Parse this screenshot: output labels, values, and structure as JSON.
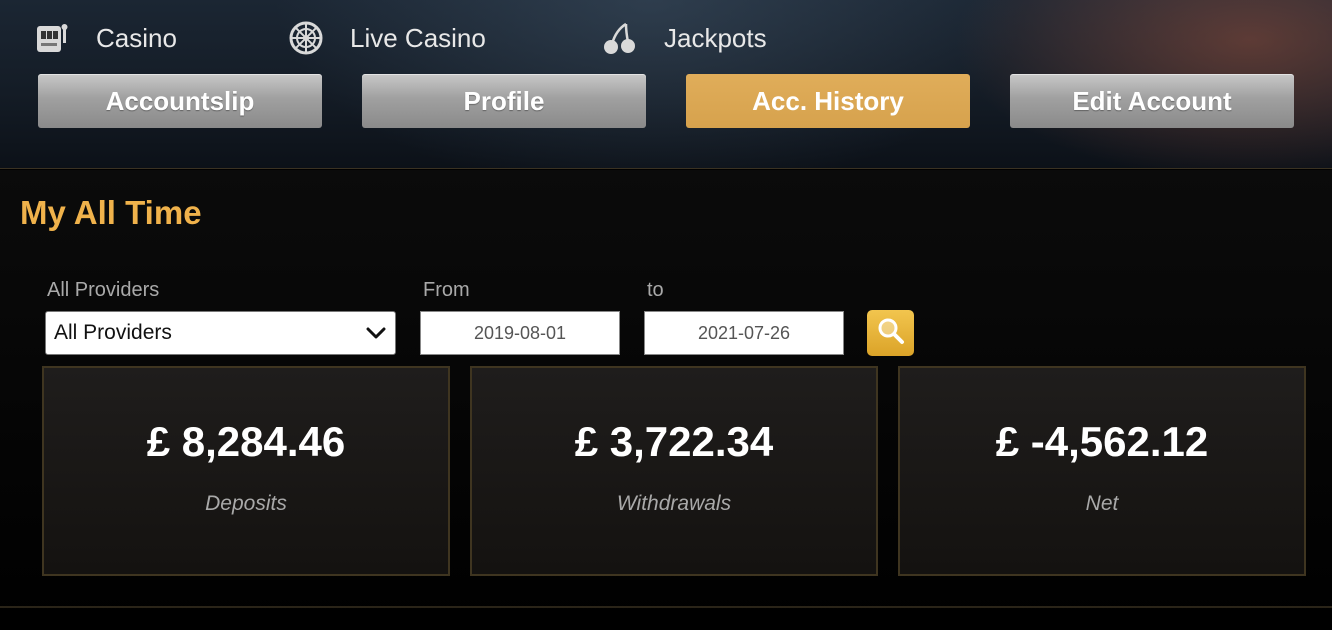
{
  "nav": [
    {
      "label": "Casino",
      "icon": "slot-machine-icon"
    },
    {
      "label": "Live Casino",
      "icon": "roulette-wheel-icon"
    },
    {
      "label": "Jackpots",
      "icon": "cherries-icon"
    }
  ],
  "tabs": [
    {
      "label": "Accountslip",
      "active": false
    },
    {
      "label": "Profile",
      "active": false
    },
    {
      "label": "Acc. History",
      "active": true
    },
    {
      "label": "Edit Account",
      "active": false
    }
  ],
  "section": {
    "title": "My All Time"
  },
  "filters": {
    "provider_label": "All Providers",
    "provider_selected": "All Providers",
    "from_label": "From",
    "from_value": "2019-08-01",
    "to_label": "to",
    "to_value": "2021-07-26",
    "search_icon": "magnifier-icon"
  },
  "summary": [
    {
      "amount": "£ 8,284.46",
      "caption": "Deposits"
    },
    {
      "amount": "£ 3,722.34",
      "caption": "Withdrawals"
    },
    {
      "amount": "£ -4,562.12",
      "caption": "Net"
    }
  ],
  "colors": {
    "accent": "#d6a24d",
    "title": "#f0b24b",
    "tab_inactive": "#a0a0a0",
    "card_border": "#3f3520"
  }
}
